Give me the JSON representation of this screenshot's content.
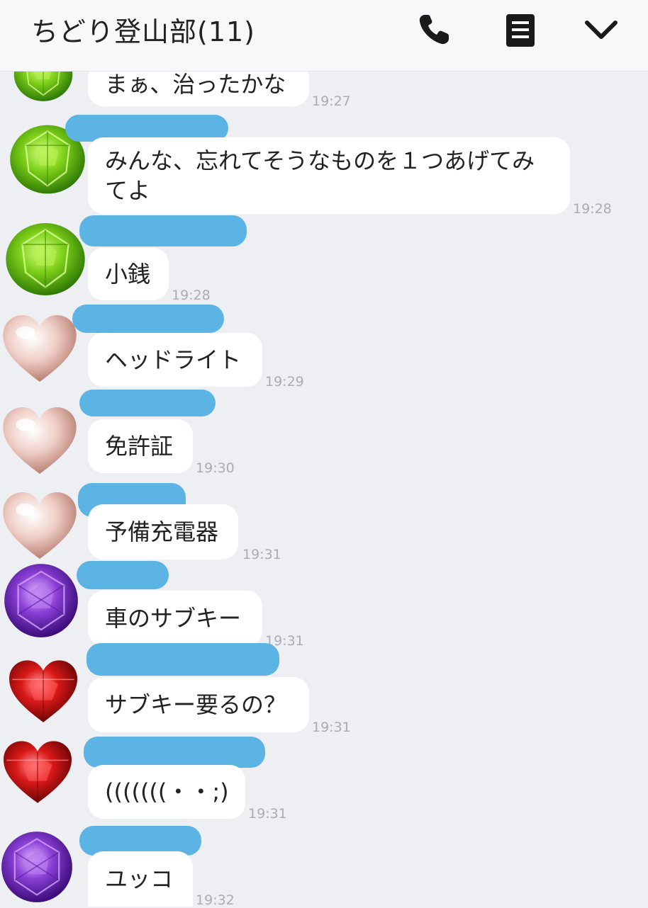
{
  "header": {
    "title": "ちどり登山部(11)",
    "call_icon": "phone-icon",
    "menu_icon": "note-list-icon",
    "collapse_icon": "chevron-down-icon"
  },
  "messages": [
    {
      "avatar": "green-gem",
      "text": "まぁ、治ったかな",
      "time": "19:27"
    },
    {
      "avatar": "green-gem",
      "text": "みんな、忘れてそうなものを１つあげてみてよ",
      "time": "19:28"
    },
    {
      "avatar": "green-gem",
      "text": "小銭",
      "time": "19:28"
    },
    {
      "avatar": "pink-heart",
      "text": "ヘッドライト",
      "time": "19:29"
    },
    {
      "avatar": "pink-heart",
      "text": "免許証",
      "time": "19:30"
    },
    {
      "avatar": "pink-heart",
      "text": "予備充電器",
      "time": "19:31"
    },
    {
      "avatar": "purple-gem",
      "text": "車のサブキー",
      "time": "19:31"
    },
    {
      "avatar": "red-heart-gem",
      "text": "サブキー要るの？",
      "time": "19:31"
    },
    {
      "avatar": "red-heart-gem",
      "text": "(((((((・・;)",
      "time": "19:31"
    },
    {
      "avatar": "purple-gem",
      "text": "ユッコ",
      "time": "19:32"
    }
  ],
  "colors": {
    "name_redaction": "#5cb4e4",
    "background": "#edeff2"
  }
}
